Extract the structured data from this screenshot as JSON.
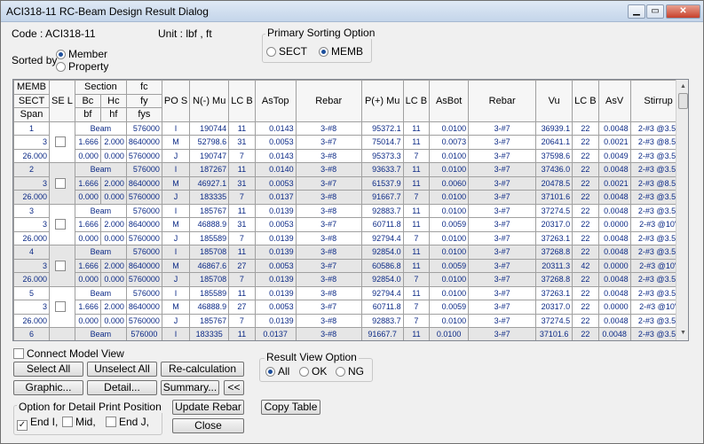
{
  "window": {
    "title": "ACI318-11 RC-Beam Design Result Dialog",
    "min": "▁",
    "max": "▭",
    "close": "✕"
  },
  "info": {
    "code": "Code : ACI318-11",
    "unit": "Unit :  lbf     ,    ft"
  },
  "sorted_by": {
    "label": "Sorted by",
    "opt1": "Member",
    "opt2": "Property",
    "selected": "Member"
  },
  "primary_sort": {
    "title": "Primary Sorting Option",
    "opt1": "SECT",
    "opt2": "MEMB",
    "selected": "MEMB"
  },
  "table": {
    "h1": [
      "MEMB",
      "SE L",
      "Section",
      "",
      "fc",
      "PO S",
      "N(-) Mu",
      "LC B",
      "AsTop",
      "Rebar",
      "P(+) Mu",
      "LC B",
      "AsBot",
      "Rebar",
      "Vu",
      "LC B",
      "AsV",
      "Stirrup"
    ],
    "h2": [
      "SECT",
      "Bc",
      "Hc",
      "fy"
    ],
    "h3": [
      "Span",
      "bf",
      "hf",
      "fys"
    ],
    "groups": [
      {
        "memb": "1",
        "sect": "3",
        "span": "26.000",
        "checked": false,
        "shaded": false,
        "rows": [
          [
            "Beam",
            "576000",
            "I",
            "190744",
            "11",
            "0.0143",
            "3-#8",
            "95372.1",
            "11",
            "0.0100",
            "3-#7",
            "36939.1",
            "22",
            "0.0048",
            "2-#3 @3.5\""
          ],
          [
            "1.666",
            "2.000",
            "8640000",
            "M",
            "52798.6",
            "31",
            "0.0053",
            "3-#7",
            "75014.7",
            "11",
            "0.0073",
            "3-#7",
            "20641.1",
            "22",
            "0.0021",
            "2-#3 @8.5\""
          ],
          [
            "0.000",
            "0.000",
            "5760000",
            "J",
            "190747",
            "7",
            "0.0143",
            "3-#8",
            "95373.3",
            "7",
            "0.0100",
            "3-#7",
            "37598.6",
            "22",
            "0.0049",
            "2-#3 @3.5\""
          ]
        ]
      },
      {
        "memb": "2",
        "sect": "3",
        "span": "26.000",
        "checked": false,
        "shaded": true,
        "rows": [
          [
            "Beam",
            "576000",
            "I",
            "187267",
            "11",
            "0.0140",
            "3-#8",
            "93633.7",
            "11",
            "0.0100",
            "3-#7",
            "37436.0",
            "22",
            "0.0048",
            "2-#3 @3.5\""
          ],
          [
            "1.666",
            "2.000",
            "8640000",
            "M",
            "46927.1",
            "31",
            "0.0053",
            "3-#7",
            "61537.9",
            "11",
            "0.0060",
            "3-#7",
            "20478.5",
            "22",
            "0.0021",
            "2-#3 @8.5\""
          ],
          [
            "0.000",
            "0.000",
            "5760000",
            "J",
            "183335",
            "7",
            "0.0137",
            "3-#8",
            "91667.7",
            "7",
            "0.0100",
            "3-#7",
            "37101.6",
            "22",
            "0.0048",
            "2-#3 @3.5\""
          ]
        ]
      },
      {
        "memb": "3",
        "sect": "3",
        "span": "26.000",
        "checked": false,
        "shaded": false,
        "rows": [
          [
            "Beam",
            "576000",
            "I",
            "185767",
            "11",
            "0.0139",
            "3-#8",
            "92883.7",
            "11",
            "0.0100",
            "3-#7",
            "37274.5",
            "22",
            "0.0048",
            "2-#3 @3.5\""
          ],
          [
            "1.666",
            "2.000",
            "8640000",
            "M",
            "46888.9",
            "31",
            "0.0053",
            "3-#7",
            "60711.8",
            "11",
            "0.0059",
            "3-#7",
            "20317.0",
            "22",
            "0.0000",
            "2-#3 @10\""
          ],
          [
            "0.000",
            "0.000",
            "5760000",
            "J",
            "185589",
            "7",
            "0.0139",
            "3-#8",
            "92794.4",
            "7",
            "0.0100",
            "3-#7",
            "37263.1",
            "22",
            "0.0048",
            "2-#3 @3.5\""
          ]
        ]
      },
      {
        "memb": "4",
        "sect": "3",
        "span": "26.000",
        "checked": false,
        "shaded": true,
        "rows": [
          [
            "Beam",
            "576000",
            "I",
            "185708",
            "11",
            "0.0139",
            "3-#8",
            "92854.0",
            "11",
            "0.0100",
            "3-#7",
            "37268.8",
            "22",
            "0.0048",
            "2-#3 @3.5\""
          ],
          [
            "1.666",
            "2.000",
            "8640000",
            "M",
            "46867.6",
            "27",
            "0.0053",
            "3-#7",
            "60586.8",
            "11",
            "0.0059",
            "3-#7",
            "20311.3",
            "42",
            "0.0000",
            "2-#3 @10\""
          ],
          [
            "0.000",
            "0.000",
            "5760000",
            "J",
            "185708",
            "7",
            "0.0139",
            "3-#8",
            "92854.0",
            "7",
            "0.0100",
            "3-#7",
            "37268.8",
            "22",
            "0.0048",
            "2-#3 @3.5\""
          ]
        ]
      },
      {
        "memb": "5",
        "sect": "3",
        "span": "26.000",
        "checked": false,
        "shaded": false,
        "rows": [
          [
            "Beam",
            "576000",
            "I",
            "185589",
            "11",
            "0.0139",
            "3-#8",
            "92794.4",
            "11",
            "0.0100",
            "3-#7",
            "37263.1",
            "22",
            "0.0048",
            "2-#3 @3.5\""
          ],
          [
            "1.666",
            "2.000",
            "8640000",
            "M",
            "46888.9",
            "27",
            "0.0053",
            "3-#7",
            "60711.8",
            "7",
            "0.0059",
            "3-#7",
            "20317.0",
            "22",
            "0.0000",
            "2-#3 @10\""
          ],
          [
            "0.000",
            "0.000",
            "5760000",
            "J",
            "185767",
            "7",
            "0.0139",
            "3-#8",
            "92883.7",
            "7",
            "0.0100",
            "3-#7",
            "37274.5",
            "22",
            "0.0048",
            "2-#3 @3.5\""
          ]
        ]
      }
    ],
    "partial_row": [
      "6",
      "Beam",
      "576000",
      "I",
      "183335",
      "11",
      "0.0137",
      "3-#8",
      "91667.7",
      "11",
      "0.0100",
      "3-#7",
      "37101.6",
      "22",
      "0.0048",
      "2-#3 @3.5\""
    ]
  },
  "connect_model_view": "Connect Model View",
  "buttons": {
    "select_all": "Select All",
    "unselect_all": "Unselect All",
    "recalc": "Re-calculation",
    "graphic": "Graphic...",
    "detail": "Detail...",
    "summary": "Summary...",
    "collapse": "<<",
    "update_rebar": "Update Rebar",
    "close": "Close",
    "copy_table": "Copy Table"
  },
  "result_view": {
    "title": "Result View Option",
    "opt1": "All",
    "opt2": "OK",
    "opt3": "NG",
    "selected": "All"
  },
  "print_position": {
    "title": "Option for Detail Print Position",
    "opt1": "End I,",
    "opt2": "Mid,",
    "opt3": "End J,",
    "checked": [
      true,
      false,
      false
    ]
  }
}
